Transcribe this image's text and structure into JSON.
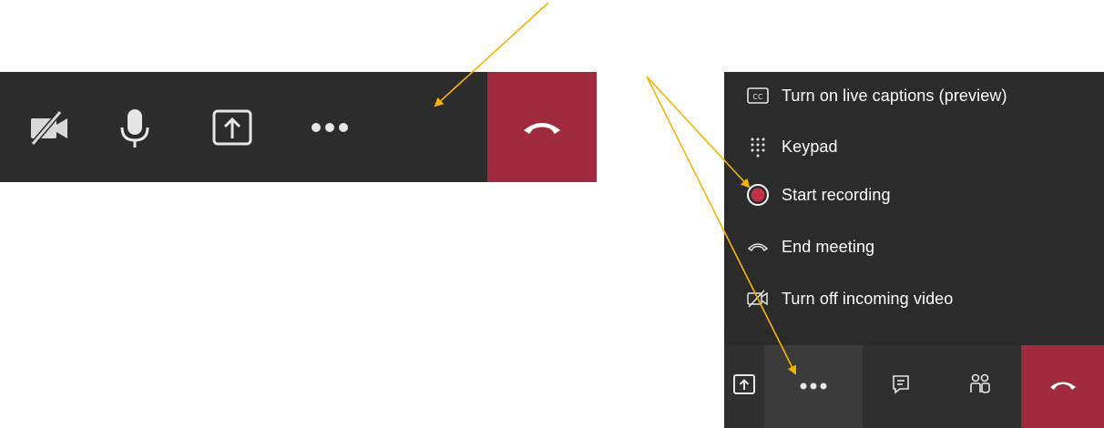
{
  "left_toolbar": {
    "buttons": [
      {
        "name": "camera-off",
        "icon": "video-off-icon"
      },
      {
        "name": "microphone",
        "icon": "microphone-icon"
      },
      {
        "name": "share-screen",
        "icon": "share-tray-icon"
      },
      {
        "name": "more-actions",
        "icon": "more-dots-icon"
      },
      {
        "name": "hang-up",
        "icon": "phone-hangup-icon"
      }
    ],
    "hangup_color": "#a02b3f",
    "background": "#2d2c2c"
  },
  "more_menu": {
    "items": [
      {
        "label": "Turn on live captions (preview)",
        "icon": "closed-captions-icon"
      },
      {
        "label": "Keypad",
        "icon": "keypad-icon"
      },
      {
        "label": "Start recording",
        "icon": "record-icon"
      },
      {
        "label": "End meeting",
        "icon": "end-call-icon"
      },
      {
        "label": "Turn off incoming video",
        "icon": "video-off-icon"
      }
    ],
    "record_color": "#c4314b"
  },
  "right_toolbar": {
    "buttons": [
      {
        "name": "share-screen",
        "icon": "share-tray-icon"
      },
      {
        "name": "more-actions",
        "icon": "more-dots-icon",
        "active": true
      },
      {
        "name": "chat",
        "icon": "chat-icon"
      },
      {
        "name": "participants",
        "icon": "people-icon"
      },
      {
        "name": "hang-up",
        "icon": "phone-hangup-icon"
      }
    ]
  },
  "annotation_color": "#f5b400"
}
